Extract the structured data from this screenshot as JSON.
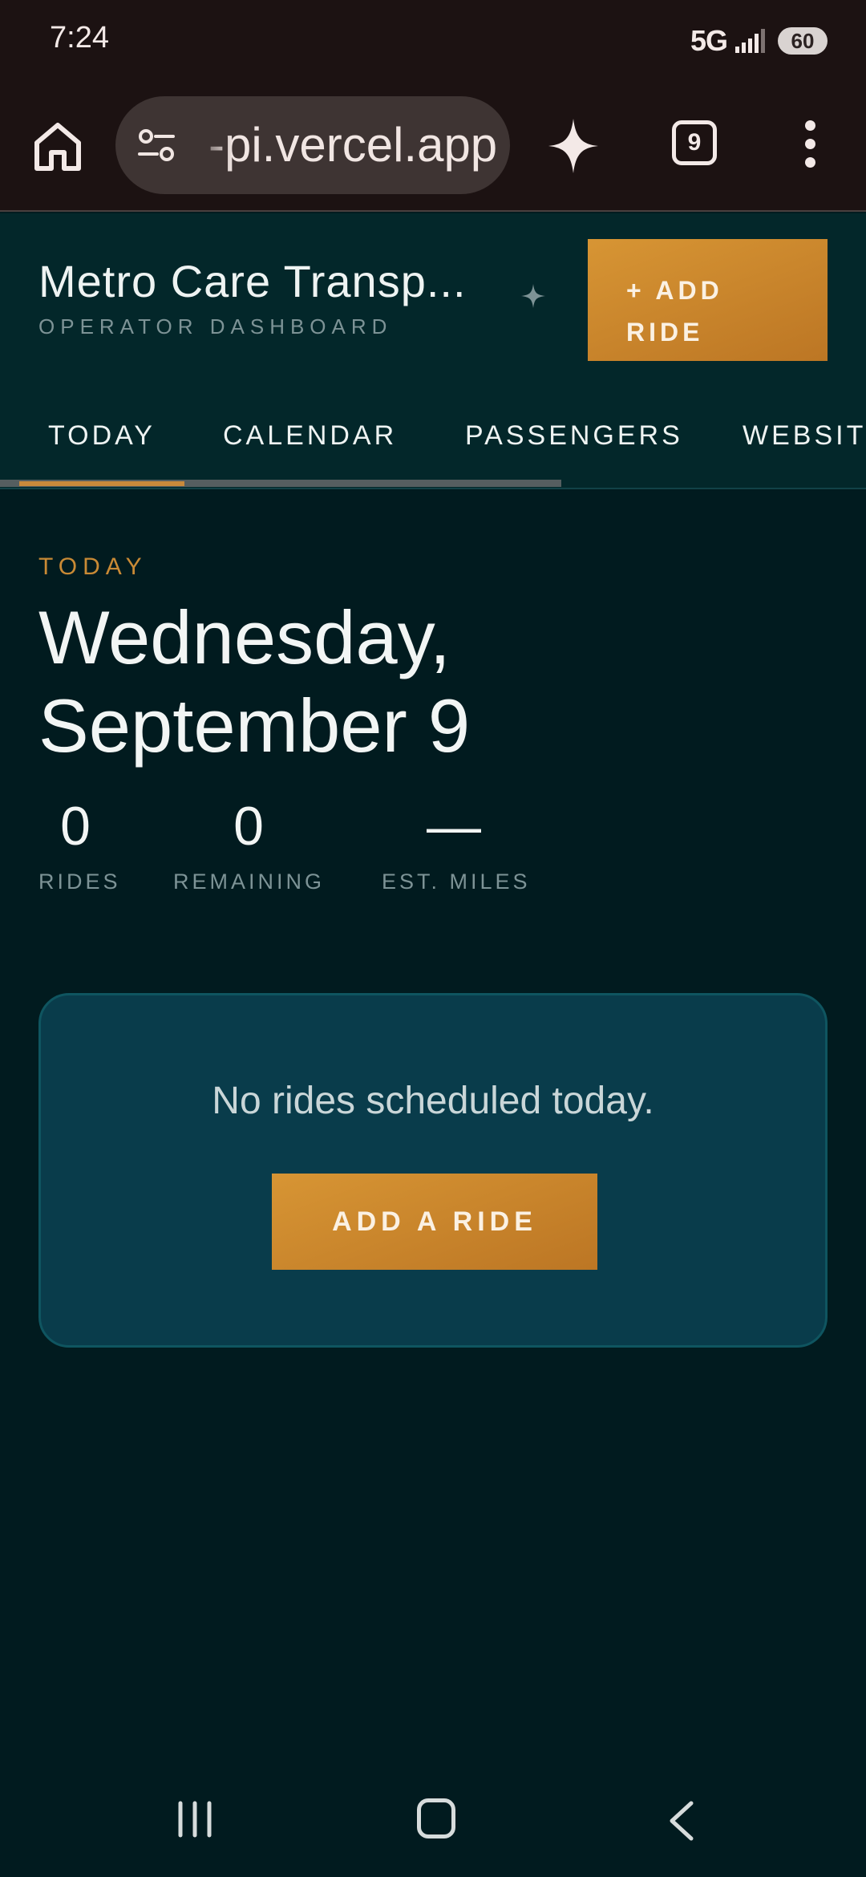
{
  "status_bar": {
    "time": "7:24",
    "network": "5G",
    "battery": "60"
  },
  "browser": {
    "url": "-pi.vercel.app",
    "tab_count": "9",
    "icons": [
      "home-icon",
      "site-settings-icon",
      "gemini-sparkle-icon",
      "tab-switcher-icon",
      "more-vert-icon"
    ]
  },
  "header": {
    "title": "Metro Care Transp...",
    "subtitle": "OPERATOR DASHBOARD",
    "add_ride_label_line1": "+ ADD",
    "add_ride_label_line2": "RIDE"
  },
  "nav": {
    "tabs": [
      {
        "label": "TODAY",
        "active": true
      },
      {
        "label": "CALENDAR",
        "active": false
      },
      {
        "label": "PASSENGERS",
        "active": false
      },
      {
        "label": "WEBSIT",
        "active": false
      }
    ]
  },
  "today": {
    "eyebrow": "TODAY",
    "date_line1": "Wednesday,",
    "date_line2": "September 9",
    "stats": [
      {
        "value": "0",
        "label": "RIDES"
      },
      {
        "value": "0",
        "label": "REMAINING"
      },
      {
        "value": "—",
        "label": "EST. MILES"
      }
    ]
  },
  "empty_state": {
    "message": "No rides scheduled today.",
    "button_label": "ADD A RIDE"
  },
  "colors": {
    "background": "#011b1f",
    "header": "#03272a",
    "accent": "#c98a35",
    "card": "#093c4b"
  }
}
